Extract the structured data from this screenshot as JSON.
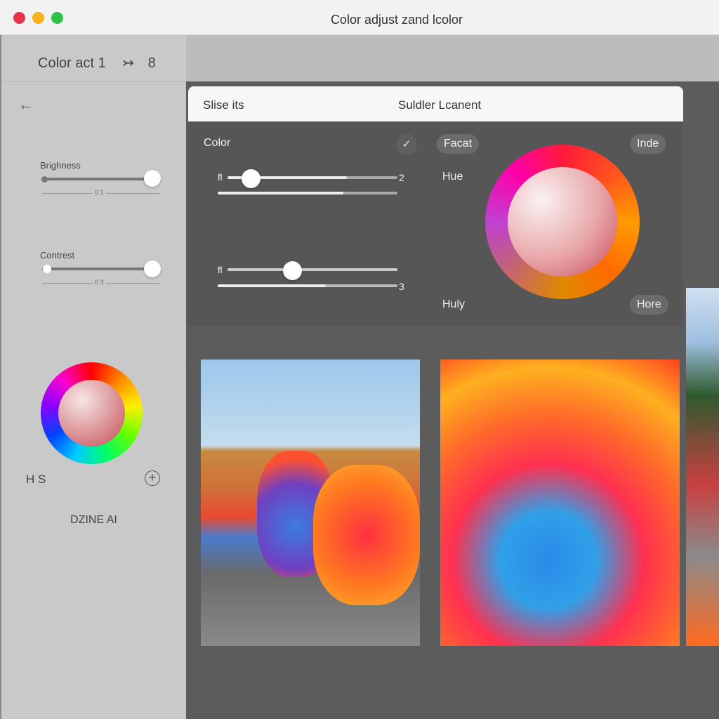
{
  "window": {
    "title": "Color adjust zand lcolor",
    "traffic_lights": [
      "#e8344a",
      "#f5b21c",
      "#2cc443"
    ]
  },
  "sidebar": {
    "header": {
      "title": "Color act 1",
      "arrow": "↣",
      "icon": "8"
    },
    "back_icon": "←",
    "brightness": {
      "label": "Brighness",
      "value": 1.0,
      "tick": "0 1"
    },
    "contrast": {
      "label": "Contrest",
      "value": 1.0,
      "tick": "0 3"
    },
    "wheel_labels": {
      "left": "H S",
      "add": "+"
    },
    "brand": "DZINE AI"
  },
  "panel": {
    "header": {
      "left": "Slise its",
      "center": "Suldler Lcanent"
    },
    "color_label": "Color",
    "check_icon": "✓",
    "slider1": {
      "min": "fl",
      "max": "2",
      "value": 0.06
    },
    "slider2": {
      "min": "fl",
      "max": "3",
      "value": 0.38
    },
    "buttons": {
      "facet": "Facat",
      "inde": "Inde",
      "more": "Hore"
    },
    "hue_label": "Hue",
    "huly_label": "Huly"
  },
  "colors": {
    "sidebar": "#c9c9c9",
    "panel": "#565656",
    "canvas": "#5c5c5c"
  }
}
